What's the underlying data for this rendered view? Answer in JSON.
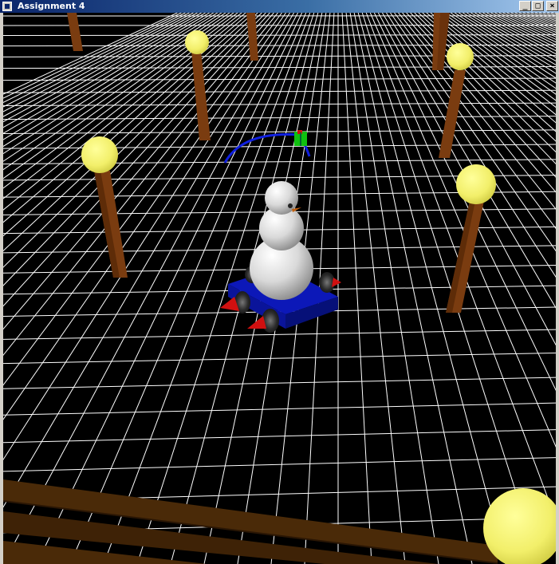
{
  "window": {
    "title": "Assignment 4",
    "buttons": {
      "minimize_symbol": "_",
      "maximize_symbol": "□",
      "close_symbol": "×"
    }
  },
  "scene": {
    "background": "#000000",
    "grid_color": "#ffffff",
    "lamp_post_color": "#7a3c10",
    "lamp_globe_color": "#f2ef6a",
    "snowman_color": "#e6e6e6",
    "cart_color": "#0c18b8",
    "wheel_cone_color": "#d01010",
    "arc_color": "#1020e0",
    "marker_color": "#10c010"
  }
}
